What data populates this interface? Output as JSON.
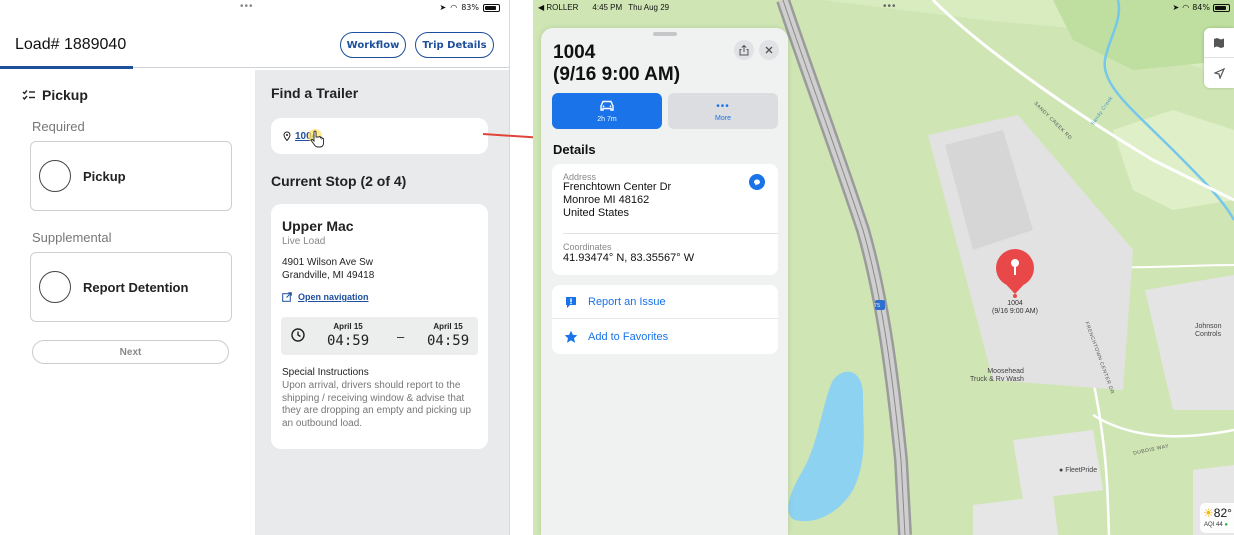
{
  "left": {
    "status": {
      "battery": "83%"
    },
    "header": {
      "title": "Load# 1889040",
      "workflow_label": "Workflow",
      "trip_details_label": "Trip Details"
    },
    "pickup": {
      "section_title": "Pickup",
      "required_label": "Required",
      "required_item": "Pickup",
      "supplemental_label": "Supplemental",
      "supplemental_item": "Report Detention",
      "next_label": "Next"
    },
    "find_trailer": {
      "title": "Find a Trailer",
      "trailer_link": "1004"
    },
    "current_stop": {
      "title": "Current Stop (2 of 4)",
      "name": "Upper Mac",
      "type": "Live Load",
      "address_line1": "4901 Wilson Ave Sw",
      "address_line2": "Grandville, MI 49418",
      "open_navigation": "Open navigation",
      "start_date": "April 15",
      "start_time": "04:59",
      "dash": "–",
      "end_date": "April 15",
      "end_time": "04:59",
      "special_title": "Special Instructions",
      "special_body": "Upon arrival, drivers should report to the shipping / receiving window & advise that they are dropping an empty and picking up an outbound load."
    }
  },
  "right": {
    "status": {
      "back_app": "◀ ROLLER",
      "time": "4:45 PM",
      "date": "Thu Aug 29",
      "battery": "84%"
    },
    "sheet": {
      "title_line1": "1004",
      "title_line2": "(9/16 9:00 AM)",
      "drive_time": "2h 7m",
      "more_label": "More",
      "details_title": "Details",
      "address_label": "Address",
      "address_line1": "Frenchtown Center Dr",
      "address_line2": "Monroe MI 48162",
      "address_line3": "United States",
      "coordinates_label": "Coordinates",
      "coordinates_value": "41.93474° N, 83.35567° W",
      "report_issue": "Report an Issue",
      "add_favorites": "Add to Favorites"
    },
    "map": {
      "pin_line1": "1004",
      "pin_line2": "(9/16 9:00 AM)",
      "poi_johnson": "Johnson\nControls",
      "poi_moosehead1": "Moosehead",
      "poi_moosehead2": "Truck & Rv Wash",
      "poi_fleetpride": "FleetPride",
      "road_sandy": "SANDY CREEK RD",
      "road_frenchtown": "FRENCHTOWN CENTER DR",
      "road_dubois": "DUBOIS WAY",
      "creek_label": "Sandy Creek",
      "highway_shield": "75",
      "temperature": "82°",
      "aqi": "AQI 44"
    }
  }
}
